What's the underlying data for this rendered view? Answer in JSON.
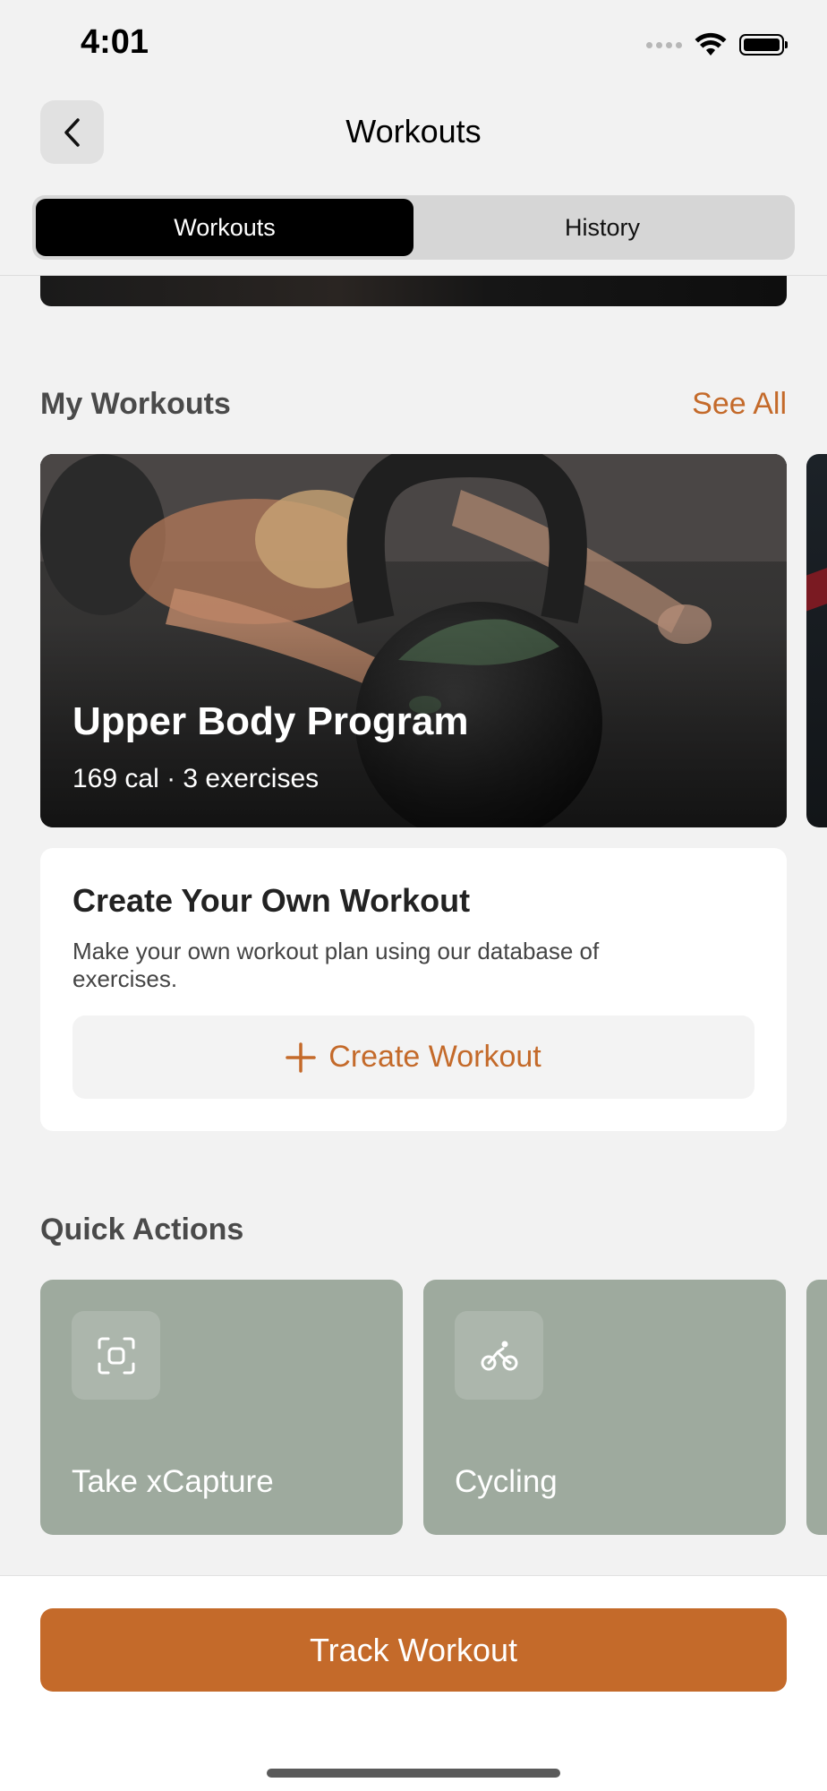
{
  "status_bar": {
    "time": "4:01"
  },
  "nav": {
    "title": "Workouts"
  },
  "segments": [
    {
      "label": "Workouts",
      "active": true
    },
    {
      "label": "History",
      "active": false
    }
  ],
  "my_workouts": {
    "title": "My Workouts",
    "see_all": "See All",
    "card": {
      "name": "Upper Body Program",
      "meta": "169 cal · 3 exercises"
    }
  },
  "create": {
    "title": "Create Your Own Workout",
    "description": "Make your own workout plan using our database of exercises.",
    "button_label": "Create Workout"
  },
  "quick_actions": {
    "title": "Quick Actions",
    "items": [
      {
        "label": "Take xCapture",
        "icon": "focus-frame-icon"
      },
      {
        "label": "Cycling",
        "icon": "cycling-icon"
      }
    ]
  },
  "bottom": {
    "track_label": "Track Workout"
  },
  "colors": {
    "accent": "#c46a2a",
    "tile": "#9eaa9e",
    "background": "#f2f2f2"
  }
}
